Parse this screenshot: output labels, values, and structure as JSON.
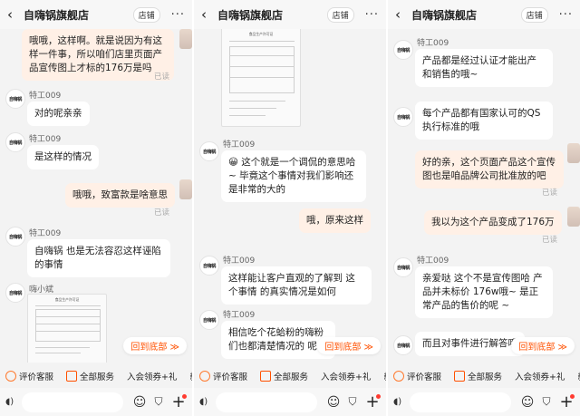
{
  "store_title": "自嗨锅旗舰店",
  "store_button": "店铺",
  "more_glyph": "···",
  "back_glyph": "‹",
  "read_label": "已读",
  "scroll_bottom_label": "回到底部",
  "chips": [
    "评价客服",
    "全部服务",
    "入会领券+礼",
    "新人"
  ],
  "input": {
    "voice_glyph": "◖)",
    "emoji_glyph": "☺",
    "bag_glyph": "⛉",
    "plus_glyph": "+"
  },
  "doc_title": "食品生产许可证",
  "brand_avatar_text": "自嗨锅",
  "panes": [
    {
      "messages": [
        {
          "who": "me",
          "text": "哦哦，这样啊。就是说因为有这样一件事，所以咱们店里页面产品宣传图上才标的176万是吗"
        },
        {
          "who": "agent",
          "sender": "特工009",
          "text": "对的呢亲亲"
        },
        {
          "who": "agent",
          "sender": "特工009",
          "text": "是这样的情况"
        },
        {
          "who": "me",
          "text": "哦哦，致富款是啥意思"
        },
        {
          "who": "agent",
          "sender": "特工009",
          "text": "自嗨锅 也是无法容忍这样诬陷的事情"
        },
        {
          "who": "agent",
          "sender": "嗨小斌",
          "text": ""
        }
      ]
    },
    {
      "messages": [
        {
          "who": "agent",
          "sender": "特工009",
          "text": "😀 这个就是一个调侃的意思哈~ 毕竟这个事情对我们影响还是非常的大的"
        },
        {
          "who": "me",
          "text": "哦，原来这样"
        },
        {
          "who": "agent",
          "sender": "特工009",
          "text": "这样能让客户直观的了解到 这个事情 的真实情况是如何"
        },
        {
          "who": "agent",
          "sender": "特工009",
          "text": "相信吃个花蛤粉的嗨粉们也都清楚情况的 呢"
        }
      ]
    },
    {
      "messages": [
        {
          "who": "agent",
          "sender": "特工009",
          "text": "产品都是经过认证才能出产和销售的哦~"
        },
        {
          "who": "agent",
          "sender": "",
          "text": "每个产品都有国家认可的QS执行标准的哦"
        },
        {
          "who": "me",
          "text": "好的亲，这个页面产品这个宣传图也是咱品牌公司批准放的吧"
        },
        {
          "who": "me",
          "text": "我以为这个产品变成了176万"
        },
        {
          "who": "agent",
          "sender": "特工009",
          "text": "亲爱哒 这个不是宣传图哈 产品并未标价 176w哦~ 是正常产品的售价的呢 ~"
        },
        {
          "who": "agent",
          "sender": "",
          "text": "而且对事件进行解答哦"
        }
      ]
    }
  ]
}
